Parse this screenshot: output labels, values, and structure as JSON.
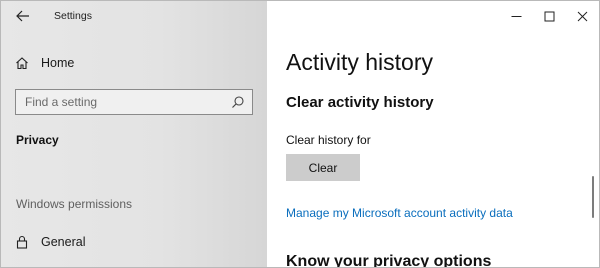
{
  "window": {
    "title": "Settings"
  },
  "sidebar": {
    "home_label": "Home",
    "search_placeholder": "Find a setting",
    "current_section": "Privacy",
    "group_header": "Windows permissions",
    "items": [
      {
        "label": "General",
        "icon": "lock-icon"
      }
    ]
  },
  "main": {
    "page_title": "Activity history",
    "section_title": "Clear activity history",
    "clear_history_label": "Clear history for",
    "clear_button_label": "Clear",
    "manage_link": "Manage my Microsoft account activity data",
    "next_section_title": "Know your privacy options"
  },
  "colors": {
    "link": "#0a6ebd",
    "button_bg": "#cccccc",
    "sidebar_bg": "#e6e6e6"
  }
}
